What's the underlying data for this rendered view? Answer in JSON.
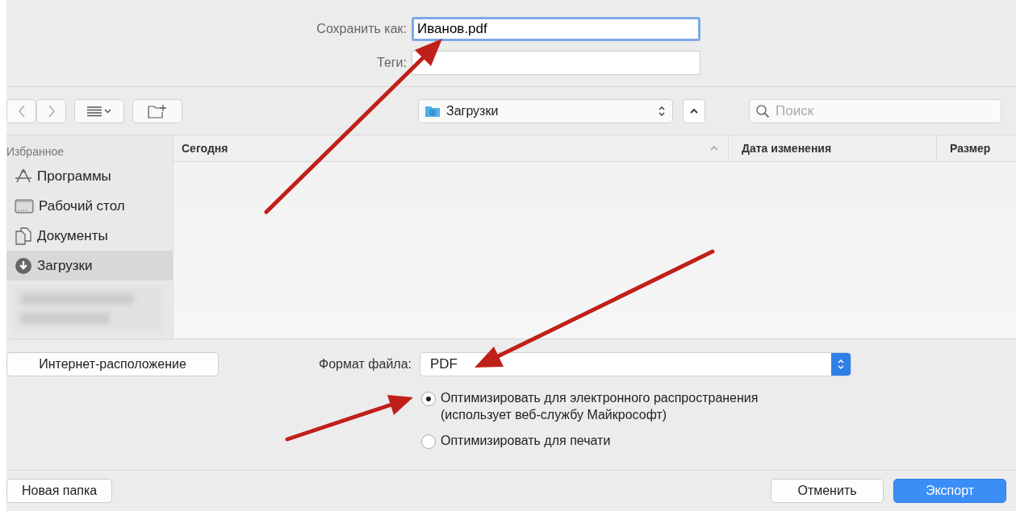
{
  "save_form": {
    "save_as_label": "Сохранить как:",
    "save_as_value": "Иванов.pdf",
    "tags_label": "Теги:"
  },
  "toolbar": {
    "location": "Загрузки",
    "search_placeholder": "Поиск"
  },
  "sidebar": {
    "heading": "Избранное",
    "items": [
      {
        "label": "Программы",
        "kind": "apps",
        "selected": false
      },
      {
        "label": "Рабочий стол",
        "kind": "desktop",
        "selected": false
      },
      {
        "label": "Документы",
        "kind": "documents",
        "selected": false
      },
      {
        "label": "Загрузки",
        "kind": "downloads",
        "selected": true
      }
    ]
  },
  "file_list": {
    "columns": [
      "Сегодня",
      "Дата изменения",
      "Размер"
    ]
  },
  "options": {
    "internet_button": "Интернет-расположение",
    "format_label": "Формат файла:",
    "format_value": "PDF",
    "radios": [
      {
        "label": "Оптимизировать для электронного распространения",
        "sublabel": "(использует веб-службу Майкрософт)",
        "selected": true
      },
      {
        "label": "Оптимизировать для печати",
        "selected": false
      }
    ]
  },
  "footer": {
    "new_folder": "Новая папка",
    "cancel": "Отменить",
    "export": "Экспорт"
  }
}
